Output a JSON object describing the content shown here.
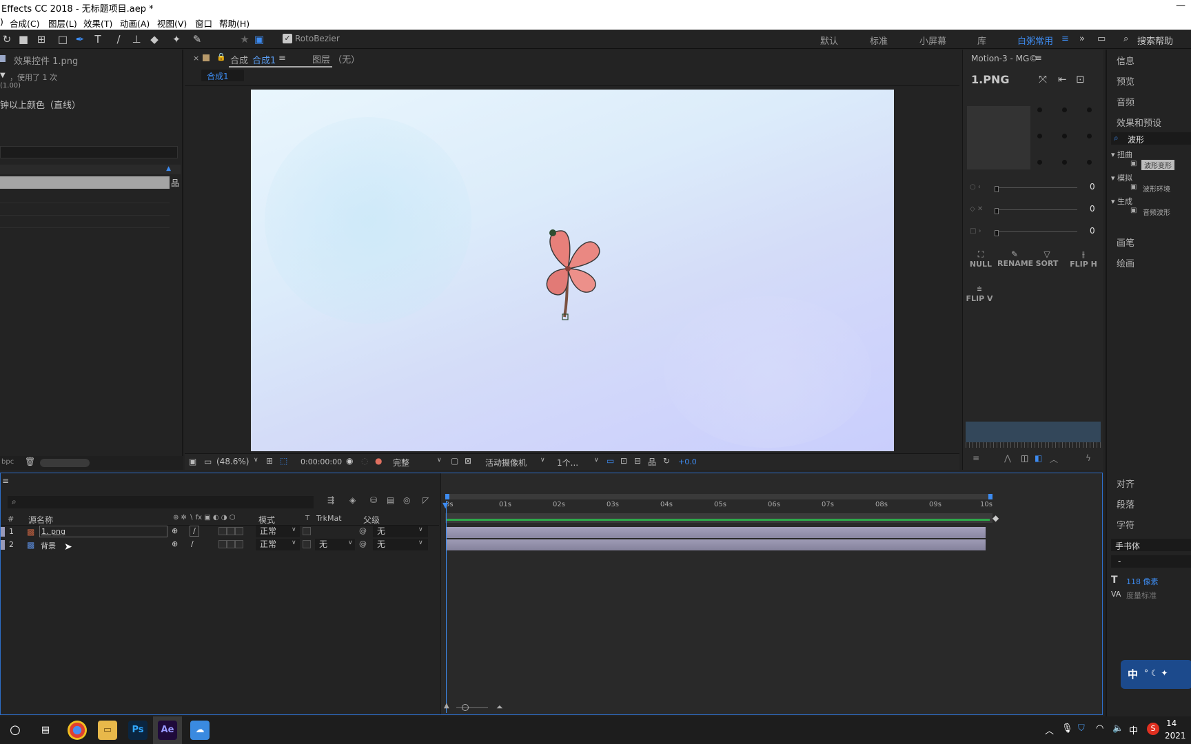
{
  "window": {
    "title": "Effects CC 2018 - 无标题项目.aep *"
  },
  "menu": [
    "合成(C)",
    "图层(L)",
    "效果(T)",
    "动画(A)",
    "视图(V)",
    "窗口",
    "帮助(H)"
  ],
  "menu_prefix": ")",
  "toolbar": {
    "rotobezier": "RotoBezier",
    "search_help": "搜索帮助"
  },
  "workspaces": [
    "默认",
    "标准",
    "小屏幕",
    "库",
    "白粥常用"
  ],
  "workspace_active": "白粥常用",
  "effects_panel": {
    "title": "效果控件 1.png",
    "usage": "，使用了 1 次",
    "value": "(1.00)",
    "note": "钟以上颜色（直线）",
    "bpc": "bpc"
  },
  "comp_panel": {
    "tab_close": "×",
    "tab_label": "合成",
    "tab_name": "合成1",
    "layer_tab": "图层 （无）",
    "breadcrumb": "合成1"
  },
  "viewer_footer": {
    "zoom": "(48.6%)",
    "timecode": "0:00:00:00",
    "resolution": "完整",
    "camera": "活动摄像机",
    "views": "1个...",
    "exposure": "+0.0"
  },
  "motion": {
    "header": "Motion-3 - MG©",
    "layer": "1.PNG",
    "sliders": [
      "0",
      "0",
      "0"
    ],
    "buttons": [
      "NULL",
      "RENAME",
      "SORT",
      "FLIP H"
    ],
    "button2": "FLIP V"
  },
  "right_panel": {
    "items_top": [
      "信息",
      "预览",
      "音频",
      "效果和预设"
    ],
    "search": "波形",
    "groups": [
      {
        "name": "扭曲",
        "item": "波形变形"
      },
      {
        "name": "模拟",
        "item": "波形环境"
      },
      {
        "name": "生成",
        "item": "音频波形"
      }
    ],
    "items_mid": [
      "画笔",
      "绘画"
    ],
    "items_bottom": [
      "对齐",
      "段落",
      "字符"
    ],
    "font": "手书体",
    "font_style": "-",
    "font_size": "118 像素",
    "tracking": "度量标准"
  },
  "timeline": {
    "columns": {
      "num": "#",
      "name": "源名称",
      "mode": "模式",
      "t": "T",
      "trkmat": "TrkMat",
      "parent": "父级"
    },
    "ruler": [
      "0s",
      "01s",
      "02s",
      "03s",
      "04s",
      "05s",
      "06s",
      "07s",
      "08s",
      "09s",
      "10s"
    ],
    "layers": [
      {
        "num": "1",
        "name": "1. png",
        "mode": "正常",
        "trkmat": "",
        "parent": "无"
      },
      {
        "num": "2",
        "name": "背景",
        "mode": "正常",
        "trkmat": "无",
        "parent": "无"
      }
    ]
  },
  "taskbar": {
    "apps": [
      "Ps",
      "Ae"
    ],
    "ime": "中",
    "time": "14",
    "date": "2021"
  },
  "colors": {
    "accent": "#3d8bf0",
    "layer_bar": "#8f8ca6",
    "workarea": "#2ea84a"
  }
}
